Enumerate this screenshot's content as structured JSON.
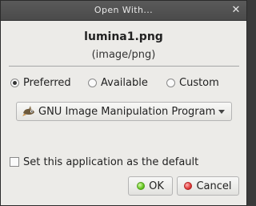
{
  "window": {
    "title": "Open With...",
    "close_glyph": "✕"
  },
  "file": {
    "name": "lumina1.png",
    "mimetype": "(image/png)"
  },
  "filter": {
    "options": [
      {
        "label": "Preferred",
        "selected": true
      },
      {
        "label": "Available",
        "selected": false
      },
      {
        "label": "Custom",
        "selected": false
      }
    ]
  },
  "application": {
    "selected_label": "GNU Image Manipulation Program",
    "icon": "gimp-icon"
  },
  "default_checkbox": {
    "label": "Set this application as the default",
    "checked": false
  },
  "buttons": {
    "ok_label": "OK",
    "cancel_label": "Cancel"
  },
  "colors": {
    "ok_indicator": "#63c81e",
    "cancel_indicator": "#e13a3a",
    "titlebar": "#4f4f4f",
    "dialog_background": "#ecebe8"
  }
}
